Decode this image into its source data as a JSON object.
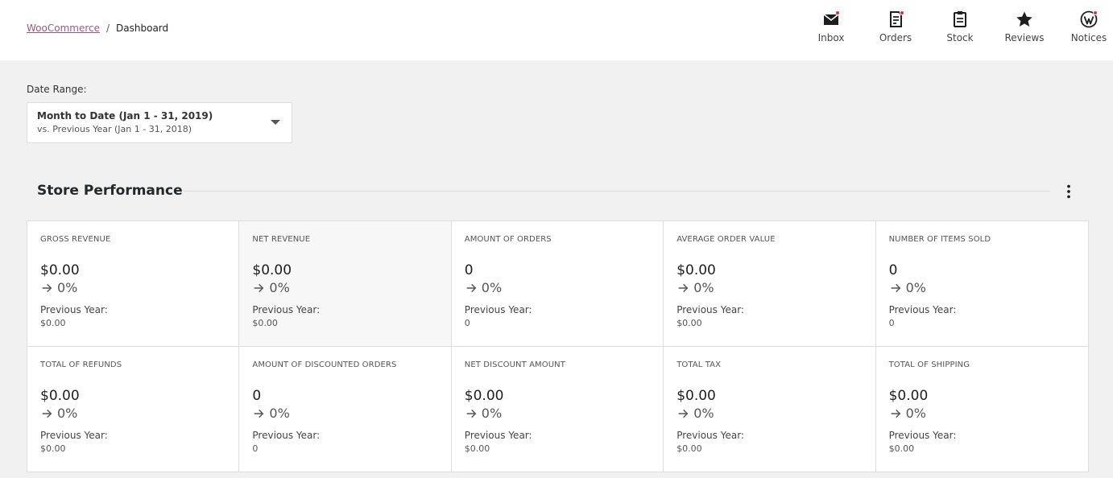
{
  "breadcrumb": {
    "parent": "WooCommerce",
    "separator": "/",
    "current": "Dashboard"
  },
  "activity": [
    {
      "label": "Inbox",
      "icon": "inbox-icon",
      "unread": true
    },
    {
      "label": "Orders",
      "icon": "orders-icon",
      "unread": true
    },
    {
      "label": "Stock",
      "icon": "stock-icon",
      "unread": false
    },
    {
      "label": "Reviews",
      "icon": "star-icon",
      "unread": false
    },
    {
      "label": "Notices",
      "icon": "wordpress-icon",
      "unread": true
    }
  ],
  "date_range": {
    "label": "Date Range:",
    "main": "Month to Date (Jan 1 - 31, 2019)",
    "compare": "vs. Previous Year (Jan 1 - 31, 2018)"
  },
  "section": {
    "title": "Store Performance"
  },
  "colors": {
    "brand": "#96588a",
    "notification": "#d63638"
  },
  "prev_label": "Previous Year:",
  "metrics": [
    {
      "label": "Gross Revenue",
      "value": "$0.00",
      "delta": "0%",
      "prev": "$0.00"
    },
    {
      "label": "Net Revenue",
      "value": "$0.00",
      "delta": "0%",
      "prev": "$0.00",
      "selected": true
    },
    {
      "label": "Amount of Orders",
      "value": "0",
      "delta": "0%",
      "prev": "0"
    },
    {
      "label": "Average Order Value",
      "value": "$0.00",
      "delta": "0%",
      "prev": "$0.00"
    },
    {
      "label": "Number of Items Sold",
      "value": "0",
      "delta": "0%",
      "prev": "0"
    },
    {
      "label": "Total of Refunds",
      "value": "$0.00",
      "delta": "0%",
      "prev": "$0.00"
    },
    {
      "label": "Amount of Discounted Orders",
      "value": "0",
      "delta": "0%",
      "prev": "0"
    },
    {
      "label": "Net Discount Amount",
      "value": "$0.00",
      "delta": "0%",
      "prev": "$0.00"
    },
    {
      "label": "Total Tax",
      "value": "$0.00",
      "delta": "0%",
      "prev": "$0.00"
    },
    {
      "label": "Total of Shipping",
      "value": "$0.00",
      "delta": "0%",
      "prev": "$0.00"
    }
  ]
}
